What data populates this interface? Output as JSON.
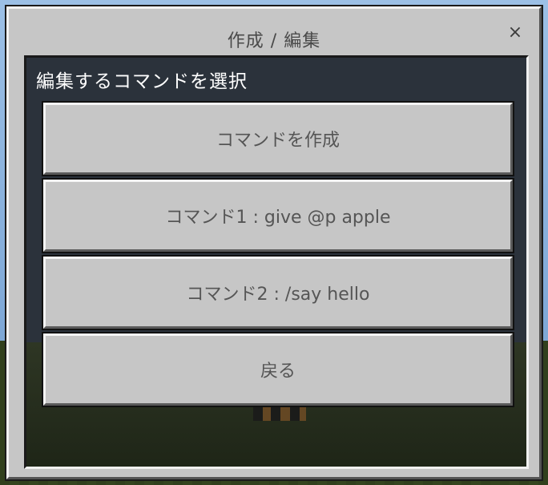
{
  "dialog": {
    "title": "作成 / 編集",
    "close_icon": "×"
  },
  "panel": {
    "heading": "編集するコマンドを選択",
    "buttons": [
      {
        "label": "コマンドを作成"
      },
      {
        "label": "コマンド1 : give @p apple"
      },
      {
        "label": "コマンド2 : /say hello"
      },
      {
        "label": "戻る"
      }
    ]
  }
}
